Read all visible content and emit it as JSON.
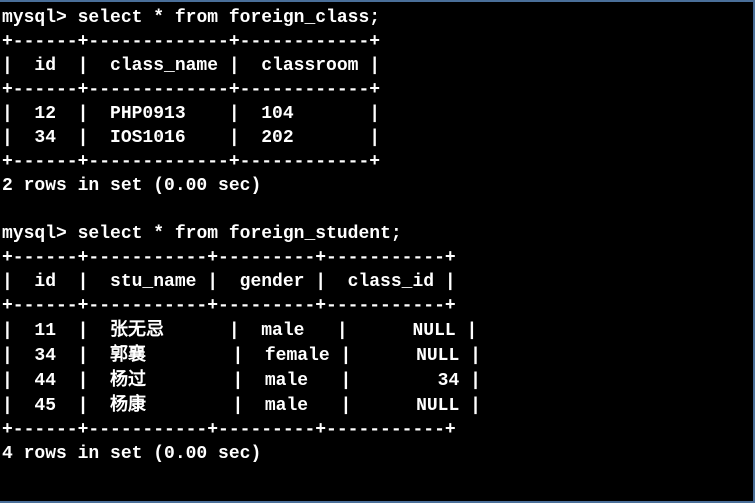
{
  "query1": {
    "prompt": "mysql>",
    "sql": "select * from foreign_class;",
    "sep_top": "+------+-------------+------------+",
    "header": "|  id  |  class_name |  classroom |",
    "sep_head": "+------+-------------+------------+",
    "row1": "|  12  |  PHP0913    |  104       |",
    "row2": "|  34  |  IOS1016    |  202       |",
    "sep_bot": "+------+-------------+------------+",
    "status": "2 rows in set (0.00 sec)"
  },
  "query2": {
    "prompt": "mysql>",
    "sql": "select * from foreign_student;",
    "sep_top": "+------+-----------+---------+-----------+",
    "header": "|  id  |  stu_name |  gender |  class_id |",
    "sep_head": "+------+-----------+---------+-----------+",
    "row1_a": "|  11  |  ",
    "row1_name": "张无忌",
    "row1_b": "      |  male   |      NULL |",
    "row2_a": "|  34  |  ",
    "row2_name": "郭襄",
    "row2_b": "        |  female |      NULL |",
    "row3_a": "|  44  |  ",
    "row3_name": "杨过",
    "row3_b": "        |  male   |        34 |",
    "row4_a": "|  45  |  ",
    "row4_name": "杨康",
    "row4_b": "        |  male   |      NULL |",
    "sep_bot": "+------+-----------+---------+-----------+",
    "status": "4 rows in set (0.00 sec)"
  }
}
